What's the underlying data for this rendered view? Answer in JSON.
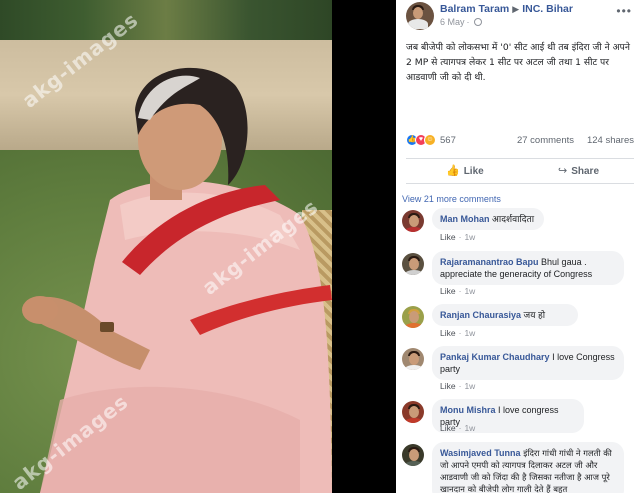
{
  "photo": {
    "watermarks": [
      "akg-images",
      "akg-images",
      "akg-images"
    ]
  },
  "post": {
    "author": "Balram Taram",
    "group": "INC. Bihar",
    "date": "6 May",
    "more_glyph": "•••",
    "text": "जब बीजेपी को लोकसभा में '0' सीट आई थी तब इंदिरा जी ने अपने 2 MP से त्यागपत्र लेकर 1 सीट पर अटल जी तथा 1 सीट पर आडवाणी जी को दी थी.",
    "reaction_count": "567",
    "comments_count": "27 comments",
    "shares_count": "124 shares",
    "like_label": "Like",
    "share_label": "Share",
    "view_more": "View 21 more comments"
  },
  "comments": [
    {
      "name": "Man Mohan",
      "text": "आदर्शवादिता",
      "like": "Like",
      "time": "1w"
    },
    {
      "name": "Rajaramanantrao Bapu",
      "text": "Bhul gaua . appreciate the generacity of Congress",
      "like": "Like",
      "time": "1w"
    },
    {
      "name": "Ranjan Chaurasiya",
      "text": "जय हो",
      "like": "Like",
      "time": "1w"
    },
    {
      "name": "Pankaj Kumar Chaudhary",
      "text": "I love Congress party",
      "like": "Like",
      "time": "1w"
    },
    {
      "name": "Monu Mishra",
      "text": "I love congress party",
      "like": "Like",
      "time": "1w"
    },
    {
      "name": "Wasimjaved Tunna",
      "text": "इंदिरा गांधी गांधी ने गलती की जो आपने एमपी को त्यागपत्र दिलाकर अटल जी और आडवाणी जी को जिंदा की है जिसका नतीजा है आज पूरे खानदान को बीजेपी लोग गाली देते हैं बहुत",
      "like": "",
      "time": ""
    }
  ],
  "colors": {
    "link_blue": "#385898",
    "facebook_blue": "#1877f2",
    "bubble_bg": "#f2f3f5",
    "muted_text": "#90949c"
  }
}
